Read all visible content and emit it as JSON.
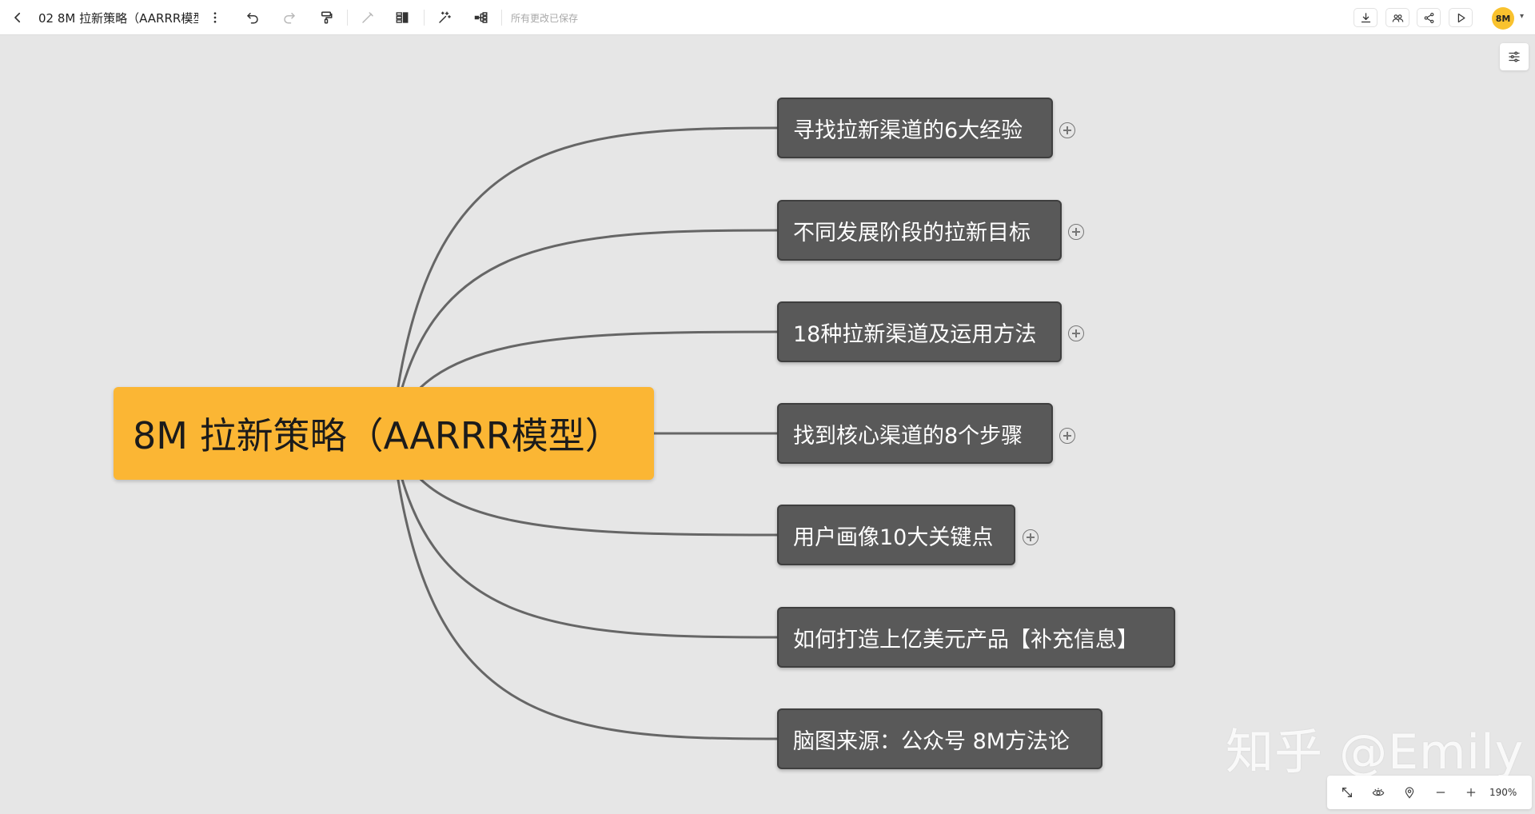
{
  "toolbar": {
    "title": "02 8M 拉新策略（AARRR模型）",
    "save_status": "所有更改已保存",
    "icons": {
      "back": "chevron-left-icon",
      "more": "more-vertical-icon",
      "undo": "undo-icon",
      "redo": "redo-icon",
      "format_painter": "format-painter-icon",
      "pen": "pen-icon",
      "outline": "outline-icon",
      "magic": "magic-wand-icon",
      "structure": "structure-icon",
      "download": "download-icon",
      "collaborate": "collaborate-icon",
      "share": "share-icon",
      "present": "play-icon"
    },
    "avatar_text": "8M",
    "avatar_color": "#f9c22e"
  },
  "mindmap": {
    "root": {
      "label": "8M 拉新策略（AARRR模型）",
      "color": "#fbb634"
    },
    "children": [
      {
        "label": "寻找拉新渠道的6大经验"
      },
      {
        "label": "不同发展阶段的拉新目标"
      },
      {
        "label": "18种拉新渠道及运用方法"
      },
      {
        "label": "找到核心渠道的8个步骤"
      },
      {
        "label": "用户画像10大关键点"
      },
      {
        "label": "如何打造上亿美元产品【补充信息】"
      },
      {
        "label": "脑图来源：公众号 8M方法论"
      }
    ],
    "child_color": "#595959",
    "line_color": "#666666"
  },
  "watermark": "知乎 @Emily",
  "bottom_bar": {
    "zoom": "190%",
    "icons": {
      "fit": "fit-screen-icon",
      "eye": "eye-icon",
      "locate": "location-pin-icon",
      "zoom_out": "minus-icon",
      "zoom_in": "plus-icon"
    }
  }
}
